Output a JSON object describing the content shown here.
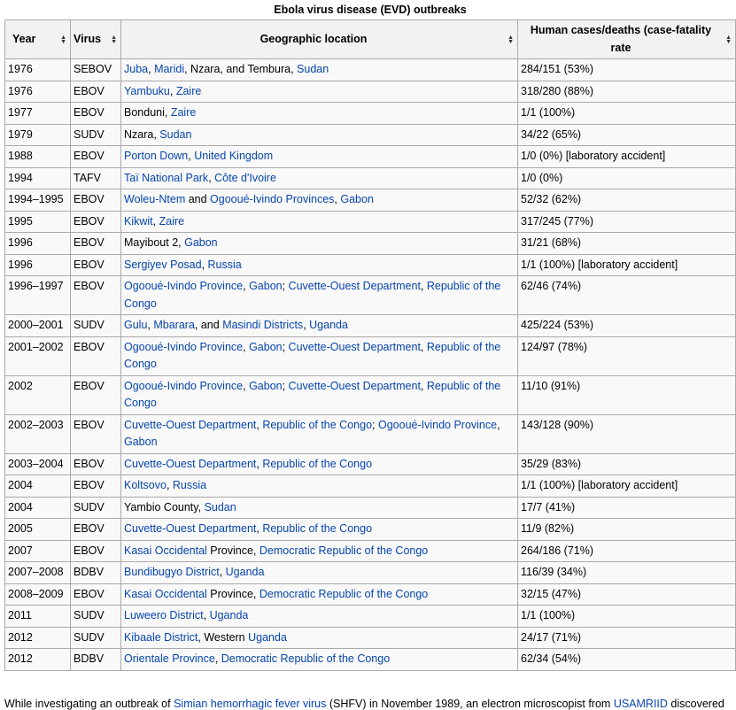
{
  "caption": "Ebola virus disease (EVD) outbreaks",
  "headers": [
    "Year",
    "Virus",
    "Geographic location",
    "Human cases/deaths (case-fatality rate"
  ],
  "rows": [
    {
      "year": "1976",
      "virus": "SEBOV",
      "loc": [
        {
          "t": "Juba",
          "l": 1
        },
        {
          "t": ", "
        },
        {
          "t": "Maridi",
          "l": 1
        },
        {
          "t": ", Nzara, and Tembura, "
        },
        {
          "t": "Sudan",
          "l": 1
        }
      ],
      "cases": "284/151 (53%)"
    },
    {
      "year": "1976",
      "virus": "EBOV",
      "loc": [
        {
          "t": "Yambuku",
          "l": 1
        },
        {
          "t": ", "
        },
        {
          "t": "Zaire",
          "l": 1
        }
      ],
      "cases": "318/280 (88%)"
    },
    {
      "year": "1977",
      "virus": "EBOV",
      "loc": [
        {
          "t": "Bonduni, "
        },
        {
          "t": "Zaire",
          "l": 1
        }
      ],
      "cases": "1/1 (100%)"
    },
    {
      "year": "1979",
      "virus": "SUDV",
      "loc": [
        {
          "t": "Nzara, "
        },
        {
          "t": "Sudan",
          "l": 1
        }
      ],
      "cases": "34/22 (65%)"
    },
    {
      "year": "1988",
      "virus": "EBOV",
      "loc": [
        {
          "t": "Porton Down",
          "l": 1
        },
        {
          "t": ", "
        },
        {
          "t": "United Kingdom",
          "l": 1
        }
      ],
      "cases": "1/0 (0%) [laboratory accident]"
    },
    {
      "year": "1994",
      "virus": "TAFV",
      "loc": [
        {
          "t": "Taï National Park",
          "l": 1
        },
        {
          "t": ", "
        },
        {
          "t": "Côte d'Ivoire",
          "l": 1
        }
      ],
      "cases": "1/0 (0%)"
    },
    {
      "year": "1994–1995",
      "virus": "EBOV",
      "loc": [
        {
          "t": "Woleu-Ntem",
          "l": 1
        },
        {
          "t": " and "
        },
        {
          "t": "Ogooué-Ivindo Provinces",
          "l": 1
        },
        {
          "t": ", "
        },
        {
          "t": "Gabon",
          "l": 1
        }
      ],
      "cases": "52/32 (62%)"
    },
    {
      "year": "1995",
      "virus": "EBOV",
      "loc": [
        {
          "t": "Kikwit",
          "l": 1
        },
        {
          "t": ", "
        },
        {
          "t": "Zaire",
          "l": 1
        }
      ],
      "cases": "317/245 (77%)"
    },
    {
      "year": "1996",
      "virus": "EBOV",
      "loc": [
        {
          "t": "Mayibout 2, "
        },
        {
          "t": "Gabon",
          "l": 1
        }
      ],
      "cases": "31/21 (68%)"
    },
    {
      "year": "1996",
      "virus": "EBOV",
      "loc": [
        {
          "t": "Sergiyev Posad",
          "l": 1
        },
        {
          "t": ", "
        },
        {
          "t": "Russia",
          "l": 1
        }
      ],
      "cases": "1/1 (100%) [laboratory accident]"
    },
    {
      "year": "1996–1997",
      "virus": "EBOV",
      "loc": [
        {
          "t": "Ogooué-Ivindo Province",
          "l": 1
        },
        {
          "t": ", "
        },
        {
          "t": "Gabon",
          "l": 1
        },
        {
          "t": "; "
        },
        {
          "t": "Cuvette-Ouest Department",
          "l": 1
        },
        {
          "t": ", "
        },
        {
          "t": "Republic of the Congo",
          "l": 1
        }
      ],
      "cases": "62/46 (74%)"
    },
    {
      "year": "2000–2001",
      "virus": "SUDV",
      "loc": [
        {
          "t": "Gulu",
          "l": 1
        },
        {
          "t": ", "
        },
        {
          "t": "Mbarara",
          "l": 1
        },
        {
          "t": ", and "
        },
        {
          "t": "Masindi Districts",
          "l": 1
        },
        {
          "t": ", "
        },
        {
          "t": "Uganda",
          "l": 1
        }
      ],
      "cases": "425/224 (53%)"
    },
    {
      "year": "2001–2002",
      "virus": "EBOV",
      "loc": [
        {
          "t": "Ogooué-Ivindo Province",
          "l": 1
        },
        {
          "t": ", "
        },
        {
          "t": "Gabon",
          "l": 1
        },
        {
          "t": "; "
        },
        {
          "t": "Cuvette-Ouest Department",
          "l": 1
        },
        {
          "t": ", "
        },
        {
          "t": "Republic of the Congo",
          "l": 1
        }
      ],
      "cases": "124/97 (78%)"
    },
    {
      "year": "2002",
      "virus": "EBOV",
      "loc": [
        {
          "t": "Ogooué-Ivindo Province",
          "l": 1
        },
        {
          "t": ", "
        },
        {
          "t": "Gabon",
          "l": 1
        },
        {
          "t": "; "
        },
        {
          "t": "Cuvette-Ouest Department",
          "l": 1
        },
        {
          "t": ", "
        },
        {
          "t": "Republic of the Congo",
          "l": 1
        }
      ],
      "cases": "11/10 (91%)"
    },
    {
      "year": "2002–2003",
      "virus": "EBOV",
      "loc": [
        {
          "t": "Cuvette-Ouest Department",
          "l": 1
        },
        {
          "t": ", "
        },
        {
          "t": "Republic of the Congo",
          "l": 1
        },
        {
          "t": "; "
        },
        {
          "t": "Ogooué-Ivindo Province",
          "l": 1
        },
        {
          "t": ", "
        },
        {
          "t": "Gabon",
          "l": 1
        }
      ],
      "cases": "143/128 (90%)"
    },
    {
      "year": "2003–2004",
      "virus": "EBOV",
      "loc": [
        {
          "t": "Cuvette-Ouest Department",
          "l": 1
        },
        {
          "t": ", "
        },
        {
          "t": "Republic of the Congo",
          "l": 1
        }
      ],
      "cases": "35/29 (83%)"
    },
    {
      "year": "2004",
      "virus": "EBOV",
      "loc": [
        {
          "t": "Koltsovo",
          "l": 1
        },
        {
          "t": ", "
        },
        {
          "t": "Russia",
          "l": 1
        }
      ],
      "cases": "1/1 (100%) [laboratory accident]"
    },
    {
      "year": "2004",
      "virus": "SUDV",
      "loc": [
        {
          "t": "Yambio County, "
        },
        {
          "t": "Sudan",
          "l": 1
        }
      ],
      "cases": "17/7 (41%)"
    },
    {
      "year": "2005",
      "virus": "EBOV",
      "loc": [
        {
          "t": "Cuvette-Ouest Department",
          "l": 1
        },
        {
          "t": ", "
        },
        {
          "t": "Republic of the Congo",
          "l": 1
        }
      ],
      "cases": "11/9 (82%)"
    },
    {
      "year": "2007",
      "virus": "EBOV",
      "loc": [
        {
          "t": "Kasai Occidental",
          "l": 1
        },
        {
          "t": " Province, "
        },
        {
          "t": "Democratic Republic of the Congo",
          "l": 1
        }
      ],
      "cases": "264/186 (71%)"
    },
    {
      "year": "2007–2008",
      "virus": "BDBV",
      "loc": [
        {
          "t": "Bundibugyo District",
          "l": 1
        },
        {
          "t": ", "
        },
        {
          "t": "Uganda",
          "l": 1
        }
      ],
      "cases": "116/39 (34%)"
    },
    {
      "year": "2008–2009",
      "virus": "EBOV",
      "loc": [
        {
          "t": "Kasai Occidental",
          "l": 1
        },
        {
          "t": " Province, "
        },
        {
          "t": "Democratic Republic of the Congo",
          "l": 1
        }
      ],
      "cases": "32/15 (47%)"
    },
    {
      "year": "2011",
      "virus": "SUDV",
      "loc": [
        {
          "t": "Luweero District",
          "l": 1
        },
        {
          "t": ", "
        },
        {
          "t": "Uganda",
          "l": 1
        }
      ],
      "cases": "1/1 (100%)"
    },
    {
      "year": "2012",
      "virus": "SUDV",
      "loc": [
        {
          "t": "Kibaale District",
          "l": 1
        },
        {
          "t": ", Western "
        },
        {
          "t": "Uganda",
          "l": 1
        }
      ],
      "cases": "24/17 (71%)"
    },
    {
      "year": "2012",
      "virus": "BDBV",
      "loc": [
        {
          "t": "Orientale Province",
          "l": 1
        },
        {
          "t": ", "
        },
        {
          "t": "Democratic Republic of the Congo",
          "l": 1
        }
      ],
      "cases": "62/34 (54%)"
    }
  ],
  "paragraph": [
    {
      "t": "While investigating an outbreak of "
    },
    {
      "t": "Simian hemorrhagic fever virus",
      "l": 1
    },
    {
      "t": " (SHFV) in November 1989, an electron microscopist from "
    },
    {
      "t": "USAMRIID",
      "l": 1
    },
    {
      "t": " discovered"
    }
  ],
  "colors": {
    "link": "#0645ad",
    "border": "#aaa",
    "header_bg": "#f2f2f2",
    "cell_bg": "#f9f9f9"
  }
}
